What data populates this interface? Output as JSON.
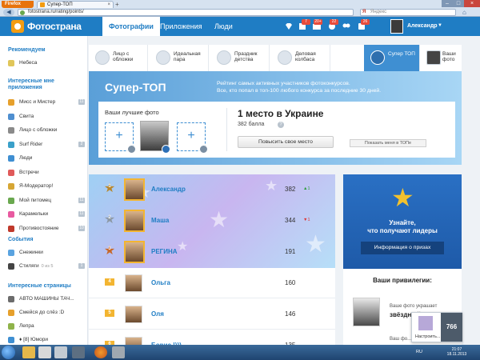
{
  "browser": {
    "app_button": "Firefox",
    "tab_title": "Супер-ТОП",
    "url": "fotostrana.ru/rating/points/",
    "search_placeholder": "Яндекс",
    "search_engine_glyph": "Я"
  },
  "header": {
    "logo": "Фотострана",
    "nav": [
      "Фотографии",
      "Приложения",
      "Люди"
    ],
    "badges": [
      "7",
      "20+",
      "22",
      "26"
    ],
    "user_name": "Александр"
  },
  "sidebar": {
    "recommended_title": "Рекомендуем",
    "recommended": [
      {
        "label": "Небеса"
      }
    ],
    "apps_title": "Интересные мне приложения",
    "apps": [
      {
        "label": "Мисс и Мистер",
        "count": "11",
        "color": "#e6a02c"
      },
      {
        "label": "Свита",
        "count": "",
        "color": "#4f8fd0"
      },
      {
        "label": "Лицо с обложки",
        "count": "",
        "color": "#8a8a8a"
      },
      {
        "label": "Surf Rider",
        "count": "2",
        "color": "#3aa0c9"
      },
      {
        "label": "Люди",
        "count": "",
        "color": "#3f8fd2"
      },
      {
        "label": "Встречи",
        "count": "",
        "color": "#e05a5a"
      },
      {
        "label": "Я-Модератор!",
        "count": "",
        "color": "#d6a634"
      },
      {
        "label": "Мой питомец",
        "count": "11",
        "color": "#6aa84f"
      },
      {
        "label": "Карамельки",
        "count": "11",
        "color": "#e85aa0"
      },
      {
        "label": "Противостояние",
        "count": "10",
        "color": "#c0392b"
      }
    ],
    "events_title": "События",
    "events": [
      {
        "label": "Снежинки",
        "sub": "",
        "count": "",
        "color": "#5aa3e0"
      },
      {
        "label": "Стиляги",
        "sub": "0 из 5",
        "count": "1",
        "color": "#444"
      }
    ],
    "pages_title": "Интересные страницы",
    "pages": [
      {
        "label": "АВТО МАШИНЫ ТАЧ...",
        "color": "#6c6c6c"
      },
      {
        "label": "Смейся до слёз :D",
        "color": "#e6a02c"
      },
      {
        "label": "Лепра",
        "color": "#8fb34a"
      },
      {
        "label": "♦ [8] Юмори",
        "color": "#3f8fd2"
      }
    ]
  },
  "categories": [
    {
      "label": "Лицо с обложки"
    },
    {
      "label": "Идеальная пара"
    },
    {
      "label": "Праздник детства"
    },
    {
      "label": "Деловая колбаса"
    },
    {
      "label": "Супер ТОП"
    },
    {
      "label": "Ваши фото"
    }
  ],
  "super_top": {
    "title": "Супер-ТОП",
    "desc1": "Рейтинг самых активных участников фотоконкурсов.",
    "desc2": "Все, кто попал в топ-100 любого конкурса за последние 30 дней.",
    "best_label": "Ваши лучшие фото",
    "place": "1 место в Украине",
    "points": "382 балла",
    "help": "?",
    "raise_button": "Повысить свое место",
    "show_button": "Показать меня в ТОПе"
  },
  "leaderboard": [
    {
      "rank": "1",
      "name": "Александр",
      "score": "382",
      "delta": "▲1",
      "dir": "up"
    },
    {
      "rank": "2",
      "name": "Маша",
      "score": "344",
      "delta": "▼1",
      "dir": "down"
    },
    {
      "rank": "3",
      "name": "РЕГИНА",
      "score": "191",
      "delta": "",
      "dir": ""
    },
    {
      "rank": "4",
      "name": "Ольга",
      "score": "160",
      "delta": "",
      "dir": ""
    },
    {
      "rank": "5",
      "name": "Оля",
      "score": "146",
      "delta": "",
      "dir": ""
    },
    {
      "rank": "6",
      "name": "Борис !)))",
      "score": "135",
      "delta": "",
      "dir": ""
    }
  ],
  "ad": {
    "line1": "Узнайте,",
    "line2": "что получают лидеры",
    "button": "Информация о призах"
  },
  "privileges": {
    "title": "Ваши привилегии:",
    "line1": "Ваше фото украшает",
    "line2": "звёздный стиль",
    "line3": "Ваш фо..."
  },
  "notification": {
    "label": "Настроить...",
    "count": "766"
  },
  "taskbar": {
    "lang": "RU",
    "time": "21:07",
    "date": "18.11.2013"
  },
  "colors": {
    "brand": "#1f7dc4",
    "accent": "#f3b531"
  }
}
